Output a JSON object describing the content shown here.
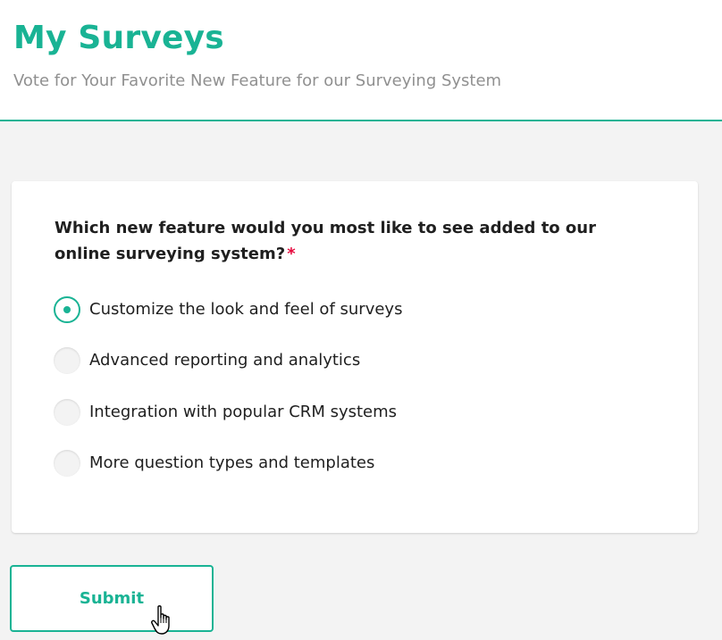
{
  "colors": {
    "accent": "#19b394",
    "required": "#e60a3e",
    "subtitle": "#909090"
  },
  "header": {
    "title": "My Surveys",
    "subtitle": "Vote for Your Favorite New Feature for our Surveying System"
  },
  "question": {
    "text": "Which new feature would you most like to see added to our online surveying system?",
    "required_marker": "*",
    "selected_index": 0,
    "choices": [
      {
        "label": "Customize the look and feel of surveys",
        "selected": true
      },
      {
        "label": "Advanced reporting and analytics",
        "selected": false
      },
      {
        "label": "Integration with popular CRM systems",
        "selected": false
      },
      {
        "label": "More question types and templates",
        "selected": false
      }
    ]
  },
  "actions": {
    "submit_label": "Submit"
  },
  "cursor": {
    "type": "hand-pointer"
  }
}
